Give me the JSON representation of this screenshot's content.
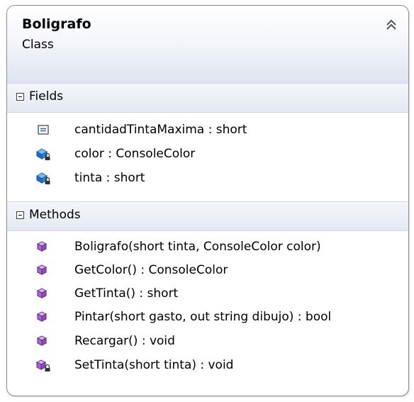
{
  "class": {
    "name": "Boligrafo",
    "kind": "Class"
  },
  "icons": {
    "collapse": "double-chevron-up-icon",
    "constant_field": "constant-field-icon",
    "private_field": "private-field-icon",
    "public_method": "method-icon",
    "private_method": "private-method-icon"
  },
  "colors": {
    "header_gradient_bottom": "#dde4f1",
    "section_bg": "#e4e9f3",
    "border": "#8a8a8a",
    "field_icon": "#1f6fc2",
    "method_icon": "#7a3fa0"
  },
  "sections": {
    "fields": {
      "label": "Fields",
      "items": [
        {
          "text": "cantidadTintaMaxima : short",
          "icon": "constant-field-icon"
        },
        {
          "text": "color : ConsoleColor",
          "icon": "private-field-icon"
        },
        {
          "text": "tinta : short",
          "icon": "private-field-icon"
        }
      ]
    },
    "methods": {
      "label": "Methods",
      "items": [
        {
          "text": "Boligrafo(short tinta, ConsoleColor color)",
          "icon": "method-icon"
        },
        {
          "text": "GetColor() : ConsoleColor",
          "icon": "method-icon"
        },
        {
          "text": "GetTinta() : short",
          "icon": "method-icon"
        },
        {
          "text": "Pintar(short gasto, out string dibujo) : bool",
          "icon": "method-icon"
        },
        {
          "text": "Recargar() : void",
          "icon": "method-icon"
        },
        {
          "text": "SetTinta(short tinta) : void",
          "icon": "private-method-icon"
        }
      ]
    }
  }
}
